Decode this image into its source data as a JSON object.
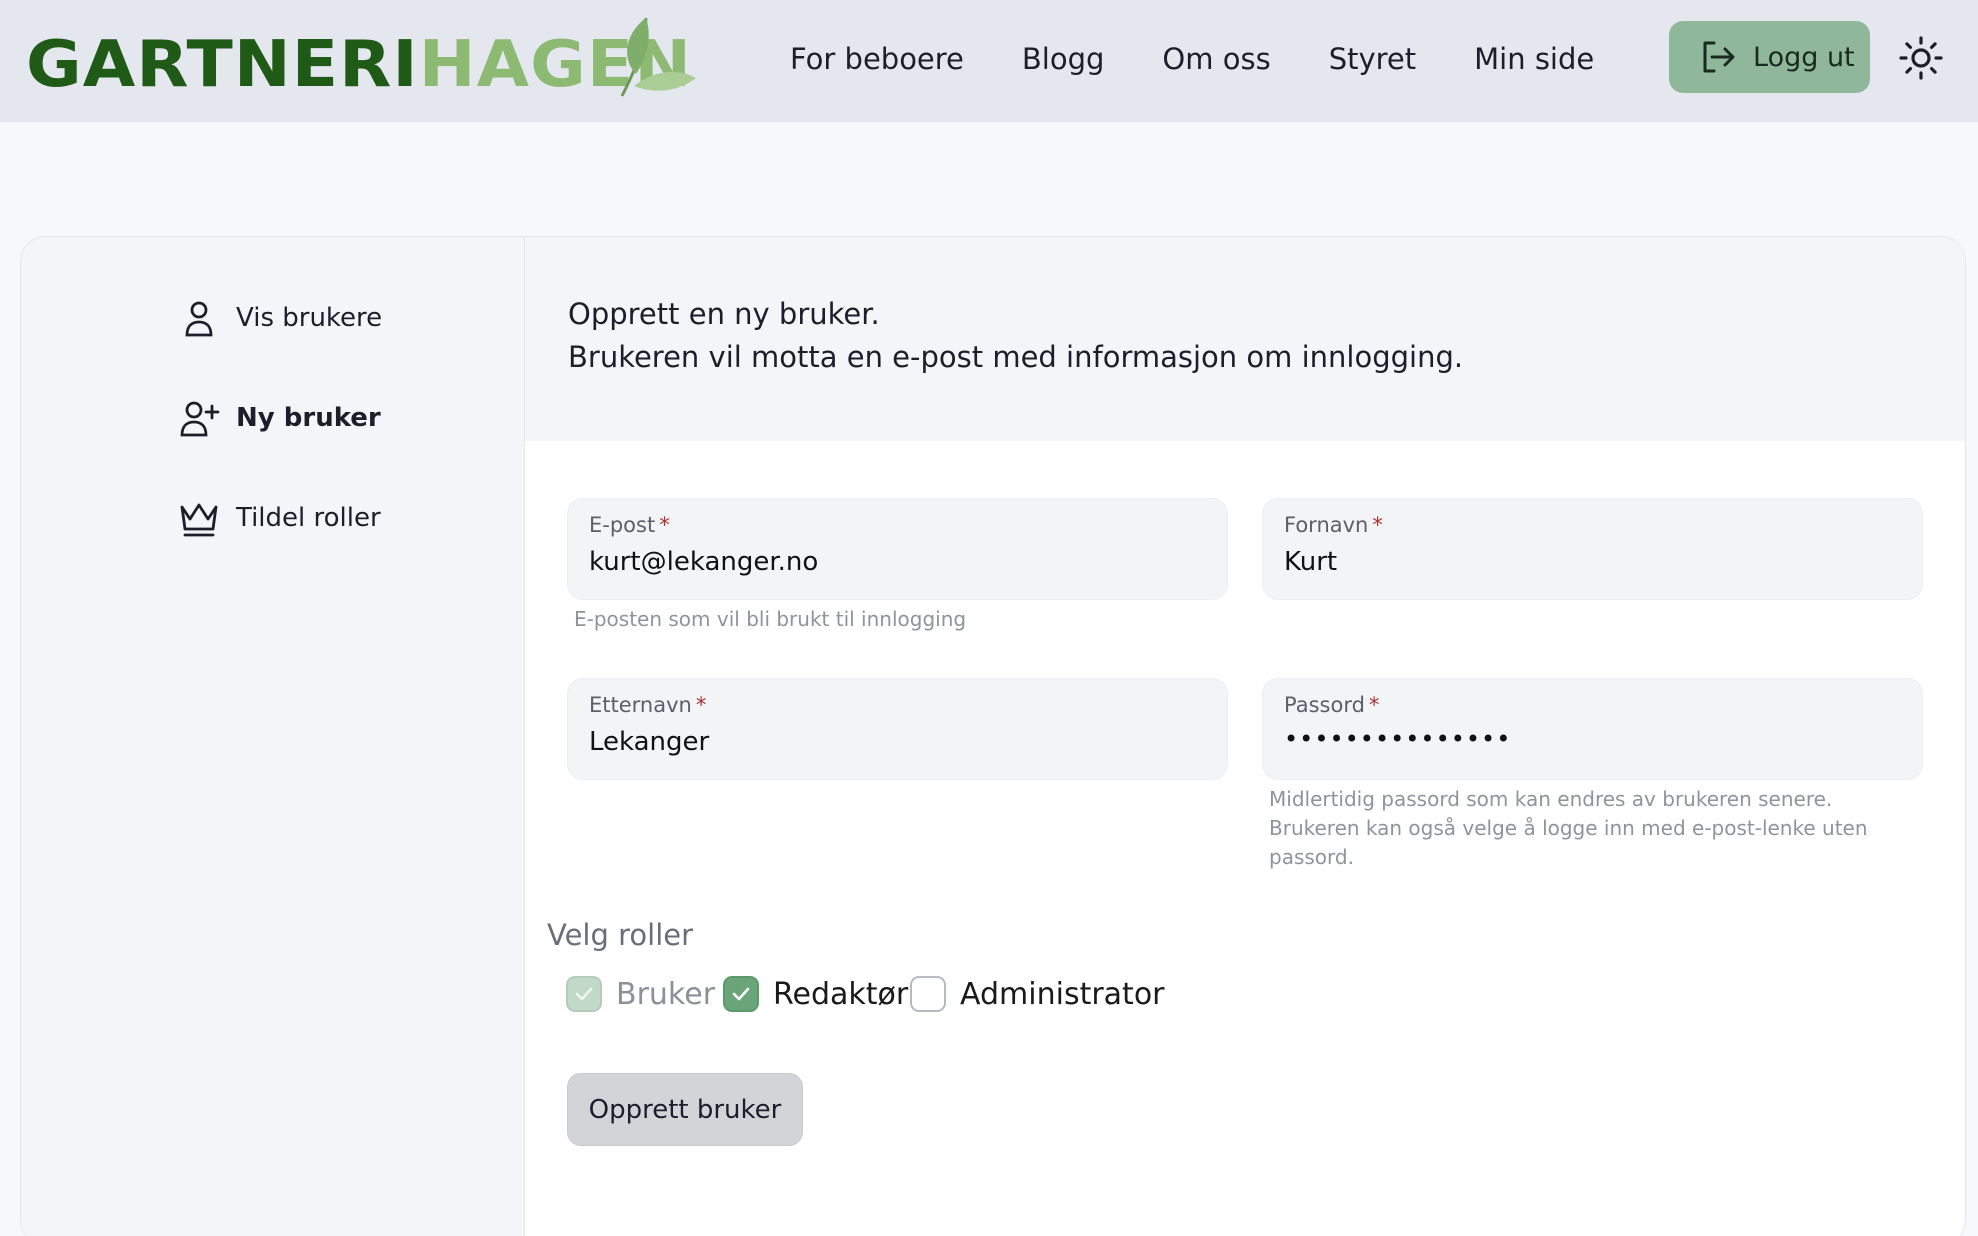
{
  "header": {
    "logo": {
      "part1": "GARTNERI",
      "part2": "HAGEN"
    },
    "nav": [
      "For beboere",
      "Blogg",
      "Om oss",
      "Styret",
      "Min side"
    ],
    "logout_label": "Logg ut"
  },
  "sidebar": {
    "items": [
      {
        "label": "Vis brukere",
        "icon": "user-icon",
        "active": false
      },
      {
        "label": "Ny bruker",
        "icon": "user-plus-icon",
        "active": true
      },
      {
        "label": "Tildel roller",
        "icon": "crown-icon",
        "active": false
      }
    ]
  },
  "intro": {
    "line1": "Opprett en ny bruker.",
    "line2": "Brukeren vil motta en e-post med informasjon om innlogging."
  },
  "form": {
    "email": {
      "label": "E-post",
      "required_mark": "*",
      "value": "kurt@lekanger.no",
      "help": "E-posten som vil bli brukt til innlogging"
    },
    "first_name": {
      "label": "Fornavn",
      "required_mark": "*",
      "value": "Kurt"
    },
    "last_name": {
      "label": "Etternavn",
      "required_mark": "*",
      "value": "Lekanger"
    },
    "password": {
      "label": "Passord",
      "required_mark": "*",
      "value": "•••••••••••••••",
      "help_line1": "Midlertidig passord som kan endres av brukeren senere.",
      "help_line2": "Brukeren kan også velge å logge inn med e-post-lenke uten",
      "help_line3": "passord."
    }
  },
  "roles": {
    "title": "Velg roller",
    "options": [
      {
        "label": "Bruker",
        "checked": true,
        "disabled": true
      },
      {
        "label": "Redaktør",
        "checked": true,
        "disabled": false
      },
      {
        "label": "Administrator",
        "checked": false,
        "disabled": false
      }
    ]
  },
  "submit_label": "Opprett bruker",
  "colors": {
    "brand_dark": "#1f5a16",
    "brand_light": "#8dba73",
    "accent_green": "#8fb89a",
    "checkbox_green": "#6aa479"
  }
}
